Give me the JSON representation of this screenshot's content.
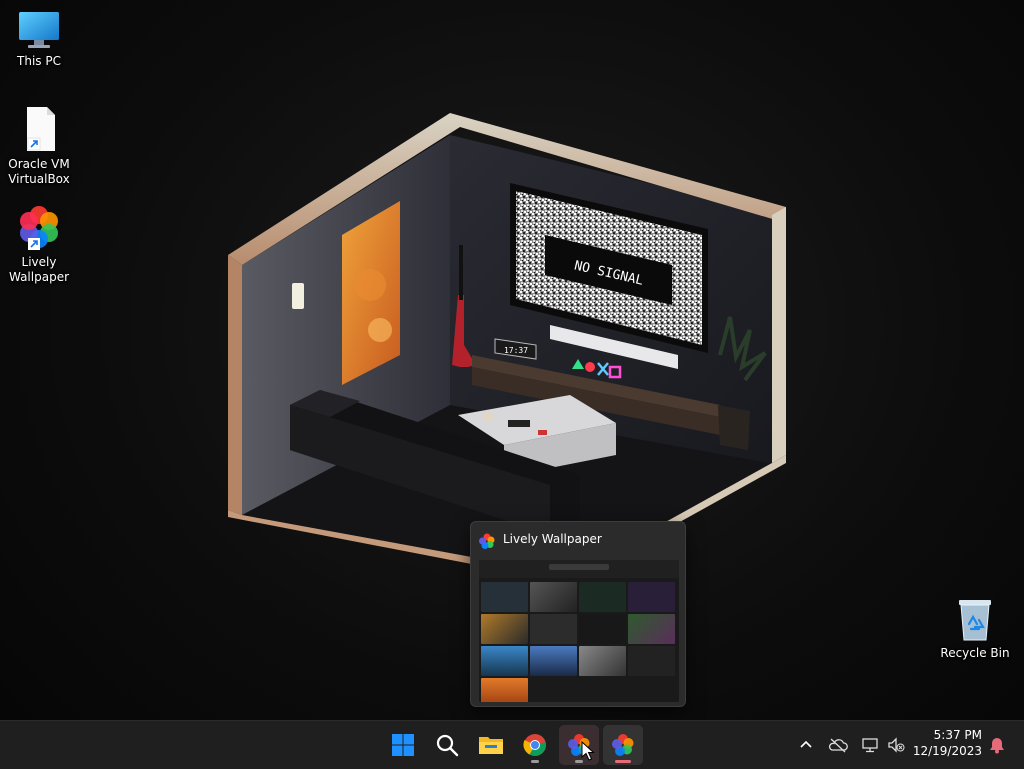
{
  "desktop": {
    "icons": [
      {
        "label": "This PC",
        "icon": "monitor-icon"
      },
      {
        "label": "Oracle VM\nVirtualBox",
        "icon": "shortcut-file-icon"
      },
      {
        "label": "Lively\nWallpaper",
        "icon": "lively-wallpaper-icon"
      },
      {
        "label": "Recycle Bin",
        "icon": "recycle-bin-icon"
      }
    ]
  },
  "wallpaper": {
    "tv_text": "NO SIGNAL",
    "clock_text": "17:37"
  },
  "preview": {
    "title": "Lively Wallpaper"
  },
  "taskbar": {
    "buttons": [
      "start-icon",
      "search-icon",
      "file-explorer-icon",
      "chrome-icon",
      "lively-wallpaper-icon",
      "lively-wallpaper-icon"
    ],
    "tray": [
      "chevron-up-icon",
      "onedrive-icon",
      "network-icon",
      "volume-muted-icon",
      "notification-bell-icon"
    ],
    "time": "5:37 PM",
    "date": "12/19/2023"
  },
  "colors": {
    "taskbar": "#1f1f1f",
    "accent": "#e56b7a",
    "start_blue": "#1e90ff"
  }
}
